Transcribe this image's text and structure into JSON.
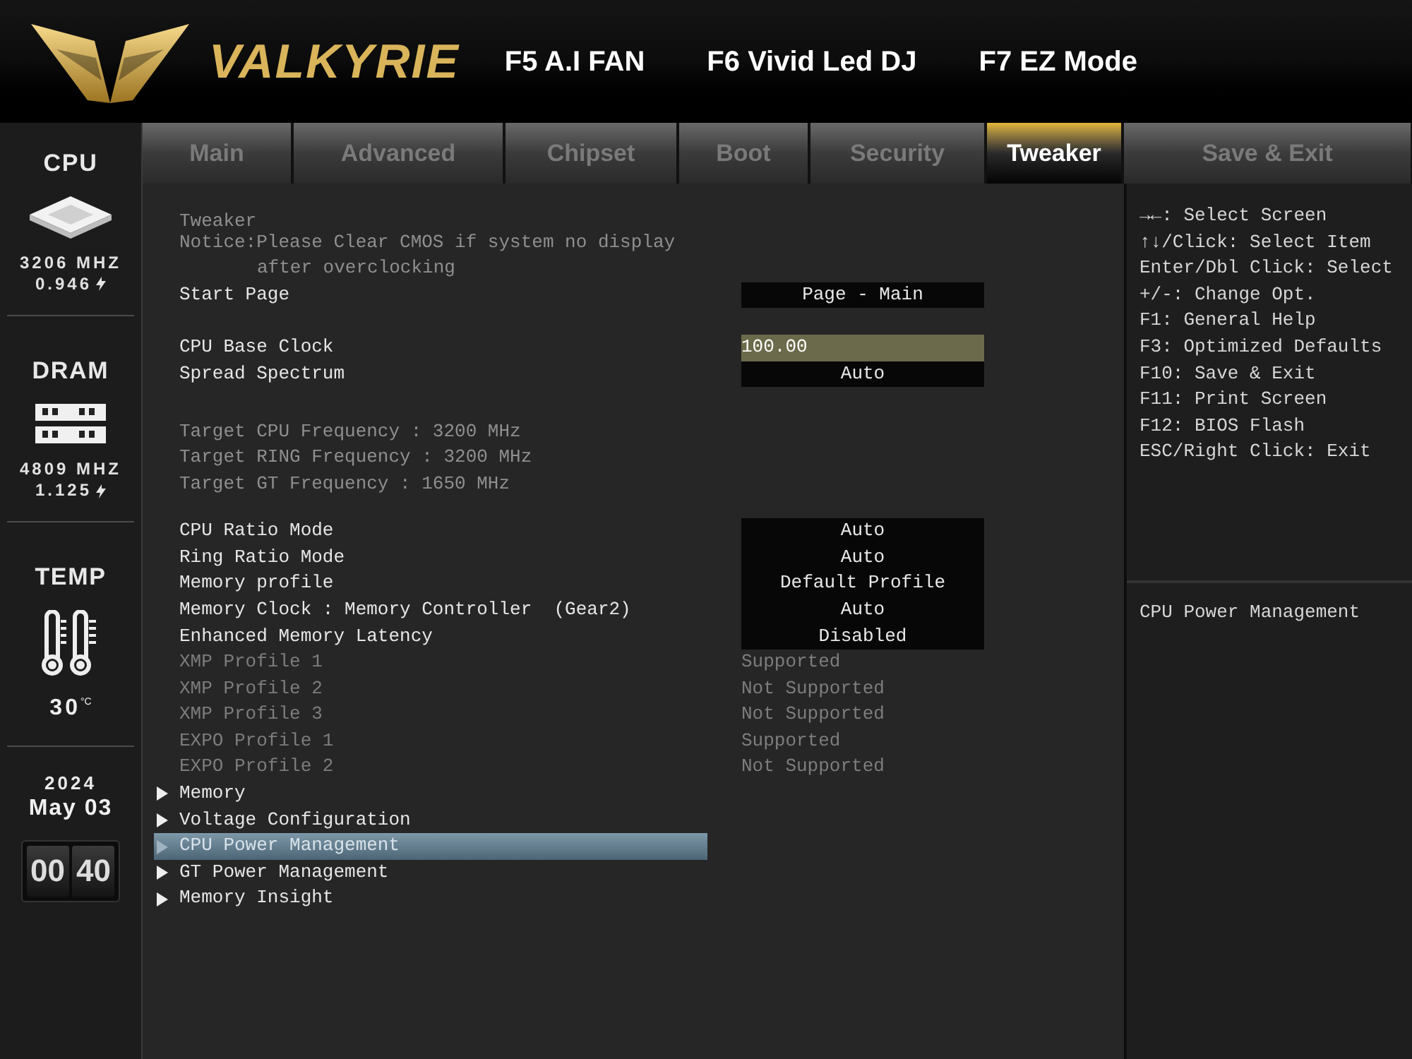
{
  "header": {
    "brand": "VALKYRIE",
    "hotkeys": [
      "F5 A.I FAN",
      "F6 Vivid Led DJ",
      "F7 EZ Mode"
    ]
  },
  "tabs": [
    {
      "label": "Main",
      "selected": false
    },
    {
      "label": "Advanced",
      "selected": false
    },
    {
      "label": "Chipset",
      "selected": false
    },
    {
      "label": "Boot",
      "selected": false
    },
    {
      "label": "Security",
      "selected": false
    },
    {
      "label": "Tweaker",
      "selected": true
    },
    {
      "label": "Save & Exit",
      "selected": false
    }
  ],
  "sidebar": {
    "cpu": {
      "title": "CPU",
      "frequency": "3206 MHZ",
      "voltage": "0.946"
    },
    "dram": {
      "title": "DRAM",
      "frequency": "4809 MHZ",
      "voltage": "1.125"
    },
    "temp": {
      "title": "TEMP",
      "value": "30",
      "unit": "°C"
    },
    "date": {
      "year": "2024",
      "day": "May 03"
    },
    "clock": {
      "hours": "00",
      "minutes": "40"
    }
  },
  "rows": [
    {
      "kind": "text",
      "label": "Tweaker"
    },
    {
      "kind": "notice",
      "lines": [
        "Notice:Please Clear CMOS if system no display",
        "after overclocking"
      ]
    },
    {
      "kind": "setting",
      "label": "Start Page",
      "value": {
        "kind": "select",
        "text": "Page - Main"
      }
    },
    {
      "kind": "blank"
    },
    {
      "kind": "setting",
      "label": "CPU Base Clock",
      "value": {
        "kind": "input",
        "text": "100.00"
      }
    },
    {
      "kind": "setting",
      "label": "Spread Spectrum",
      "value": {
        "kind": "select",
        "text": "Auto"
      }
    },
    {
      "kind": "blank"
    },
    {
      "kind": "text",
      "label": "Target CPU Frequency : 3200 MHz"
    },
    {
      "kind": "text",
      "label": "Target RING Frequency : 3200 MHz"
    },
    {
      "kind": "text",
      "label": "Target GT Frequency : 1650 MHz"
    },
    {
      "kind": "blank"
    },
    {
      "kind": "setting",
      "label": "CPU Ratio Mode",
      "value": {
        "kind": "select",
        "text": "Auto"
      }
    },
    {
      "kind": "setting",
      "label": "Ring Ratio Mode",
      "value": {
        "kind": "select",
        "text": "Auto"
      }
    },
    {
      "kind": "setting",
      "label": "Memory profile",
      "value": {
        "kind": "select",
        "text": "Default Profile"
      }
    },
    {
      "kind": "setting",
      "label": "Memory Clock : Memory Controller  (Gear2)",
      "value": {
        "kind": "select",
        "text": "Auto"
      }
    },
    {
      "kind": "setting",
      "label": "Enhanced Memory Latency",
      "value": {
        "kind": "select",
        "text": "Disabled"
      }
    },
    {
      "kind": "info",
      "label": "XMP Profile 1",
      "value": "Supported"
    },
    {
      "kind": "info",
      "label": "XMP Profile 2",
      "value": "Not Supported"
    },
    {
      "kind": "info",
      "label": "XMP Profile 3",
      "value": "Not Supported"
    },
    {
      "kind": "info",
      "label": "EXPO Profile 1",
      "value": "Supported"
    },
    {
      "kind": "info",
      "label": "EXPO Profile 2",
      "value": "Not Supported"
    },
    {
      "kind": "submenu",
      "label": "Memory",
      "selected": false
    },
    {
      "kind": "submenu",
      "label": "Voltage Configuration",
      "selected": false
    },
    {
      "kind": "submenu",
      "label": "CPU Power Management",
      "selected": true
    },
    {
      "kind": "submenu",
      "label": "GT Power Management",
      "selected": false
    },
    {
      "kind": "submenu",
      "label": "Memory Insight",
      "selected": false
    }
  ],
  "help": {
    "keys": [
      "→←: Select Screen",
      "↑↓/Click: Select Item",
      "Enter/Dbl Click: Select",
      "+/-: Change Opt.",
      "F1: General Help",
      "F3: Optimized Defaults",
      "F10: Save & Exit",
      "F11: Print Screen",
      "F12: BIOS Flash",
      "ESC/Right Click: Exit"
    ],
    "description": "CPU Power Management"
  }
}
